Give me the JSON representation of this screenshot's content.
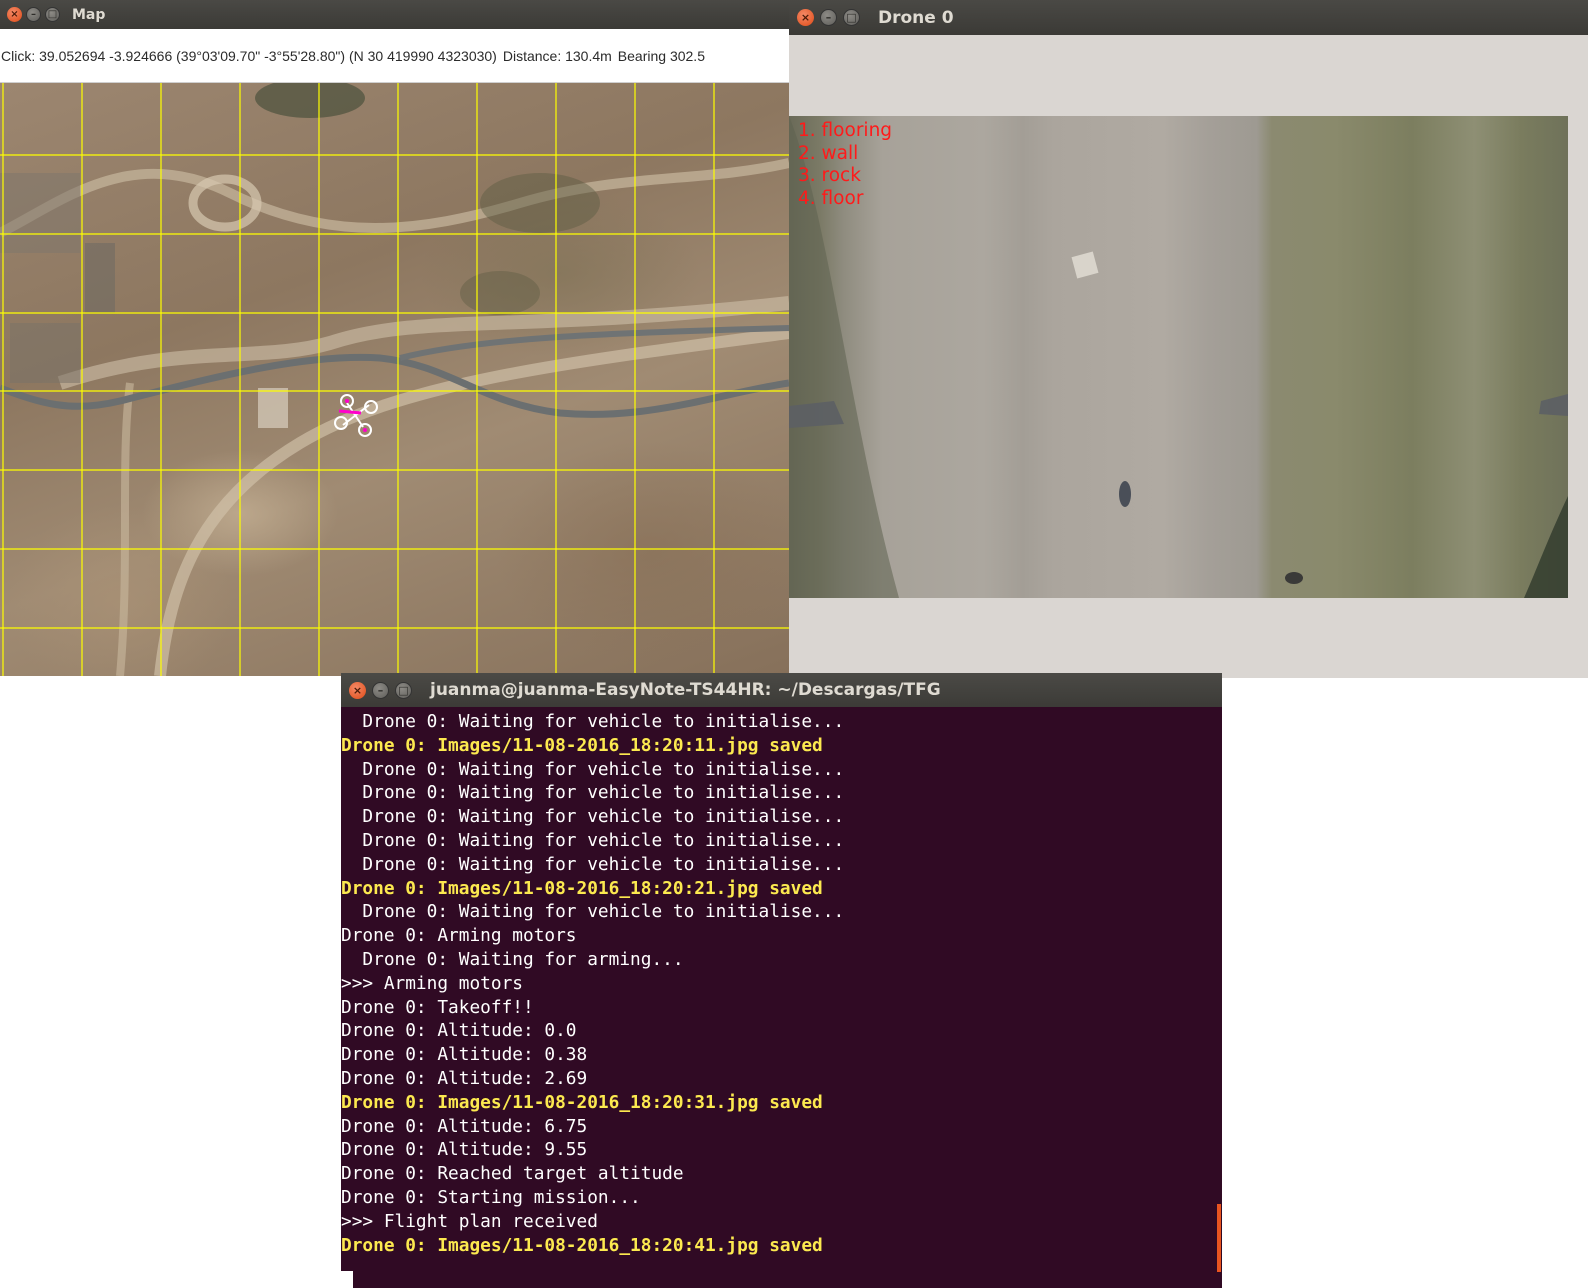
{
  "map_window": {
    "title": "Map",
    "info": {
      "click": "Click: 39.052694 -3.924666 (39°03'09.70\" -3°55'28.80\") (N 30 419990 4323030)",
      "distance": "Distance: 130.4m",
      "bearing": "Bearing 302.5"
    },
    "grid_color": "#ffff00",
    "drone_icon_color": "#ff00cc"
  },
  "drone_window": {
    "title": "Drone 0",
    "labels": [
      "1. flooring",
      "2. wall",
      "3. rock",
      "4. floor"
    ],
    "label_color": "#ff1a1a"
  },
  "terminal_window": {
    "title": "juanma@juanma-EasyNote-TS44HR: ~/Descargas/TFG",
    "lines": [
      {
        "text": "  Drone 0: Waiting for vehicle to initialise...",
        "style": "normal"
      },
      {
        "text": "Drone 0: Images/11-08-2016_18:20:11.jpg saved",
        "style": "yellow"
      },
      {
        "text": "  Drone 0: Waiting for vehicle to initialise...",
        "style": "normal"
      },
      {
        "text": "  Drone 0: Waiting for vehicle to initialise...",
        "style": "normal"
      },
      {
        "text": "  Drone 0: Waiting for vehicle to initialise...",
        "style": "normal"
      },
      {
        "text": "  Drone 0: Waiting for vehicle to initialise...",
        "style": "normal"
      },
      {
        "text": "  Drone 0: Waiting for vehicle to initialise...",
        "style": "normal"
      },
      {
        "text": "Drone 0: Images/11-08-2016_18:20:21.jpg saved",
        "style": "yellow"
      },
      {
        "text": "  Drone 0: Waiting for vehicle to initialise...",
        "style": "normal"
      },
      {
        "text": "Drone 0: Arming motors",
        "style": "normal"
      },
      {
        "text": "  Drone 0: Waiting for arming...",
        "style": "normal"
      },
      {
        "text": ">>> Arming motors",
        "style": "normal"
      },
      {
        "text": "Drone 0: Takeoff!!",
        "style": "normal"
      },
      {
        "text": "Drone 0: Altitude: 0.0",
        "style": "normal"
      },
      {
        "text": "Drone 0: Altitude: 0.38",
        "style": "normal"
      },
      {
        "text": "Drone 0: Altitude: 2.69",
        "style": "normal"
      },
      {
        "text": "Drone 0: Images/11-08-2016_18:20:31.jpg saved",
        "style": "yellow"
      },
      {
        "text": "Drone 0: Altitude: 6.75",
        "style": "normal"
      },
      {
        "text": "Drone 0: Altitude: 9.55",
        "style": "normal"
      },
      {
        "text": "Drone 0: Reached target altitude",
        "style": "normal"
      },
      {
        "text": "Drone 0: Starting mission...",
        "style": "normal"
      },
      {
        "text": ">>> Flight plan received",
        "style": "normal"
      },
      {
        "text": "Drone 0: Images/11-08-2016_18:20:41.jpg saved",
        "style": "yellow"
      }
    ],
    "background_color": "#300a24",
    "highlight_color": "#fce94f"
  },
  "window_buttons": {
    "close": "×",
    "minimize": "–",
    "maximize": "□"
  }
}
